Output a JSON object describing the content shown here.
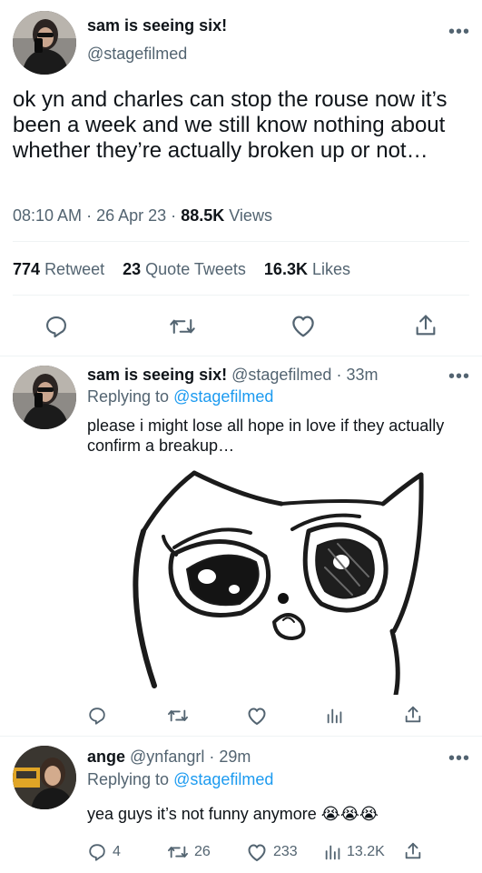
{
  "main_tweet": {
    "display_name": "sam is seeing six!",
    "handle": "@stagefilmed",
    "text": "ok yn and charles can stop the rouse now it’s been a week and we still know nothing about whether they’re actually broken up or not…",
    "time": "08:10 AM",
    "date": "26 Apr 23",
    "views_count": "88.5K",
    "views_label": "Views",
    "retweet_count": "774",
    "retweet_label": "Retweet",
    "quote_count": "23",
    "quote_label": "Quote Tweets",
    "likes_count": "16.3K",
    "likes_label": "Likes"
  },
  "reply1": {
    "display_name": "sam is seeing six!",
    "handle": "@stagefilmed",
    "time_ago": "33m",
    "replying_prefix": "Replying to",
    "replying_to": "@stagefilmed",
    "text": "please i might lose all hope in love if they actually confirm a breakup…"
  },
  "reply2": {
    "display_name": "ange",
    "handle": "@ynfangrl",
    "time_ago": "29m",
    "replying_prefix": "Replying to",
    "replying_to": "@stagefilmed",
    "text": "yea guys it’s not funny anymore 😭😭😭",
    "reply_count": "4",
    "retweet_count": "26",
    "like_count": "233",
    "views_count": "13.2K"
  },
  "separator": "·",
  "more_glyph": "•••",
  "icons": {
    "reply": "reply-icon",
    "retweet": "retweet-icon",
    "like": "heart-icon",
    "share": "share-icon",
    "views": "views-icon",
    "more": "more-icon"
  },
  "colors": {
    "text": "#0f1419",
    "muted": "#536471",
    "accent": "#1d9bf0",
    "divider": "#eff3f4"
  }
}
